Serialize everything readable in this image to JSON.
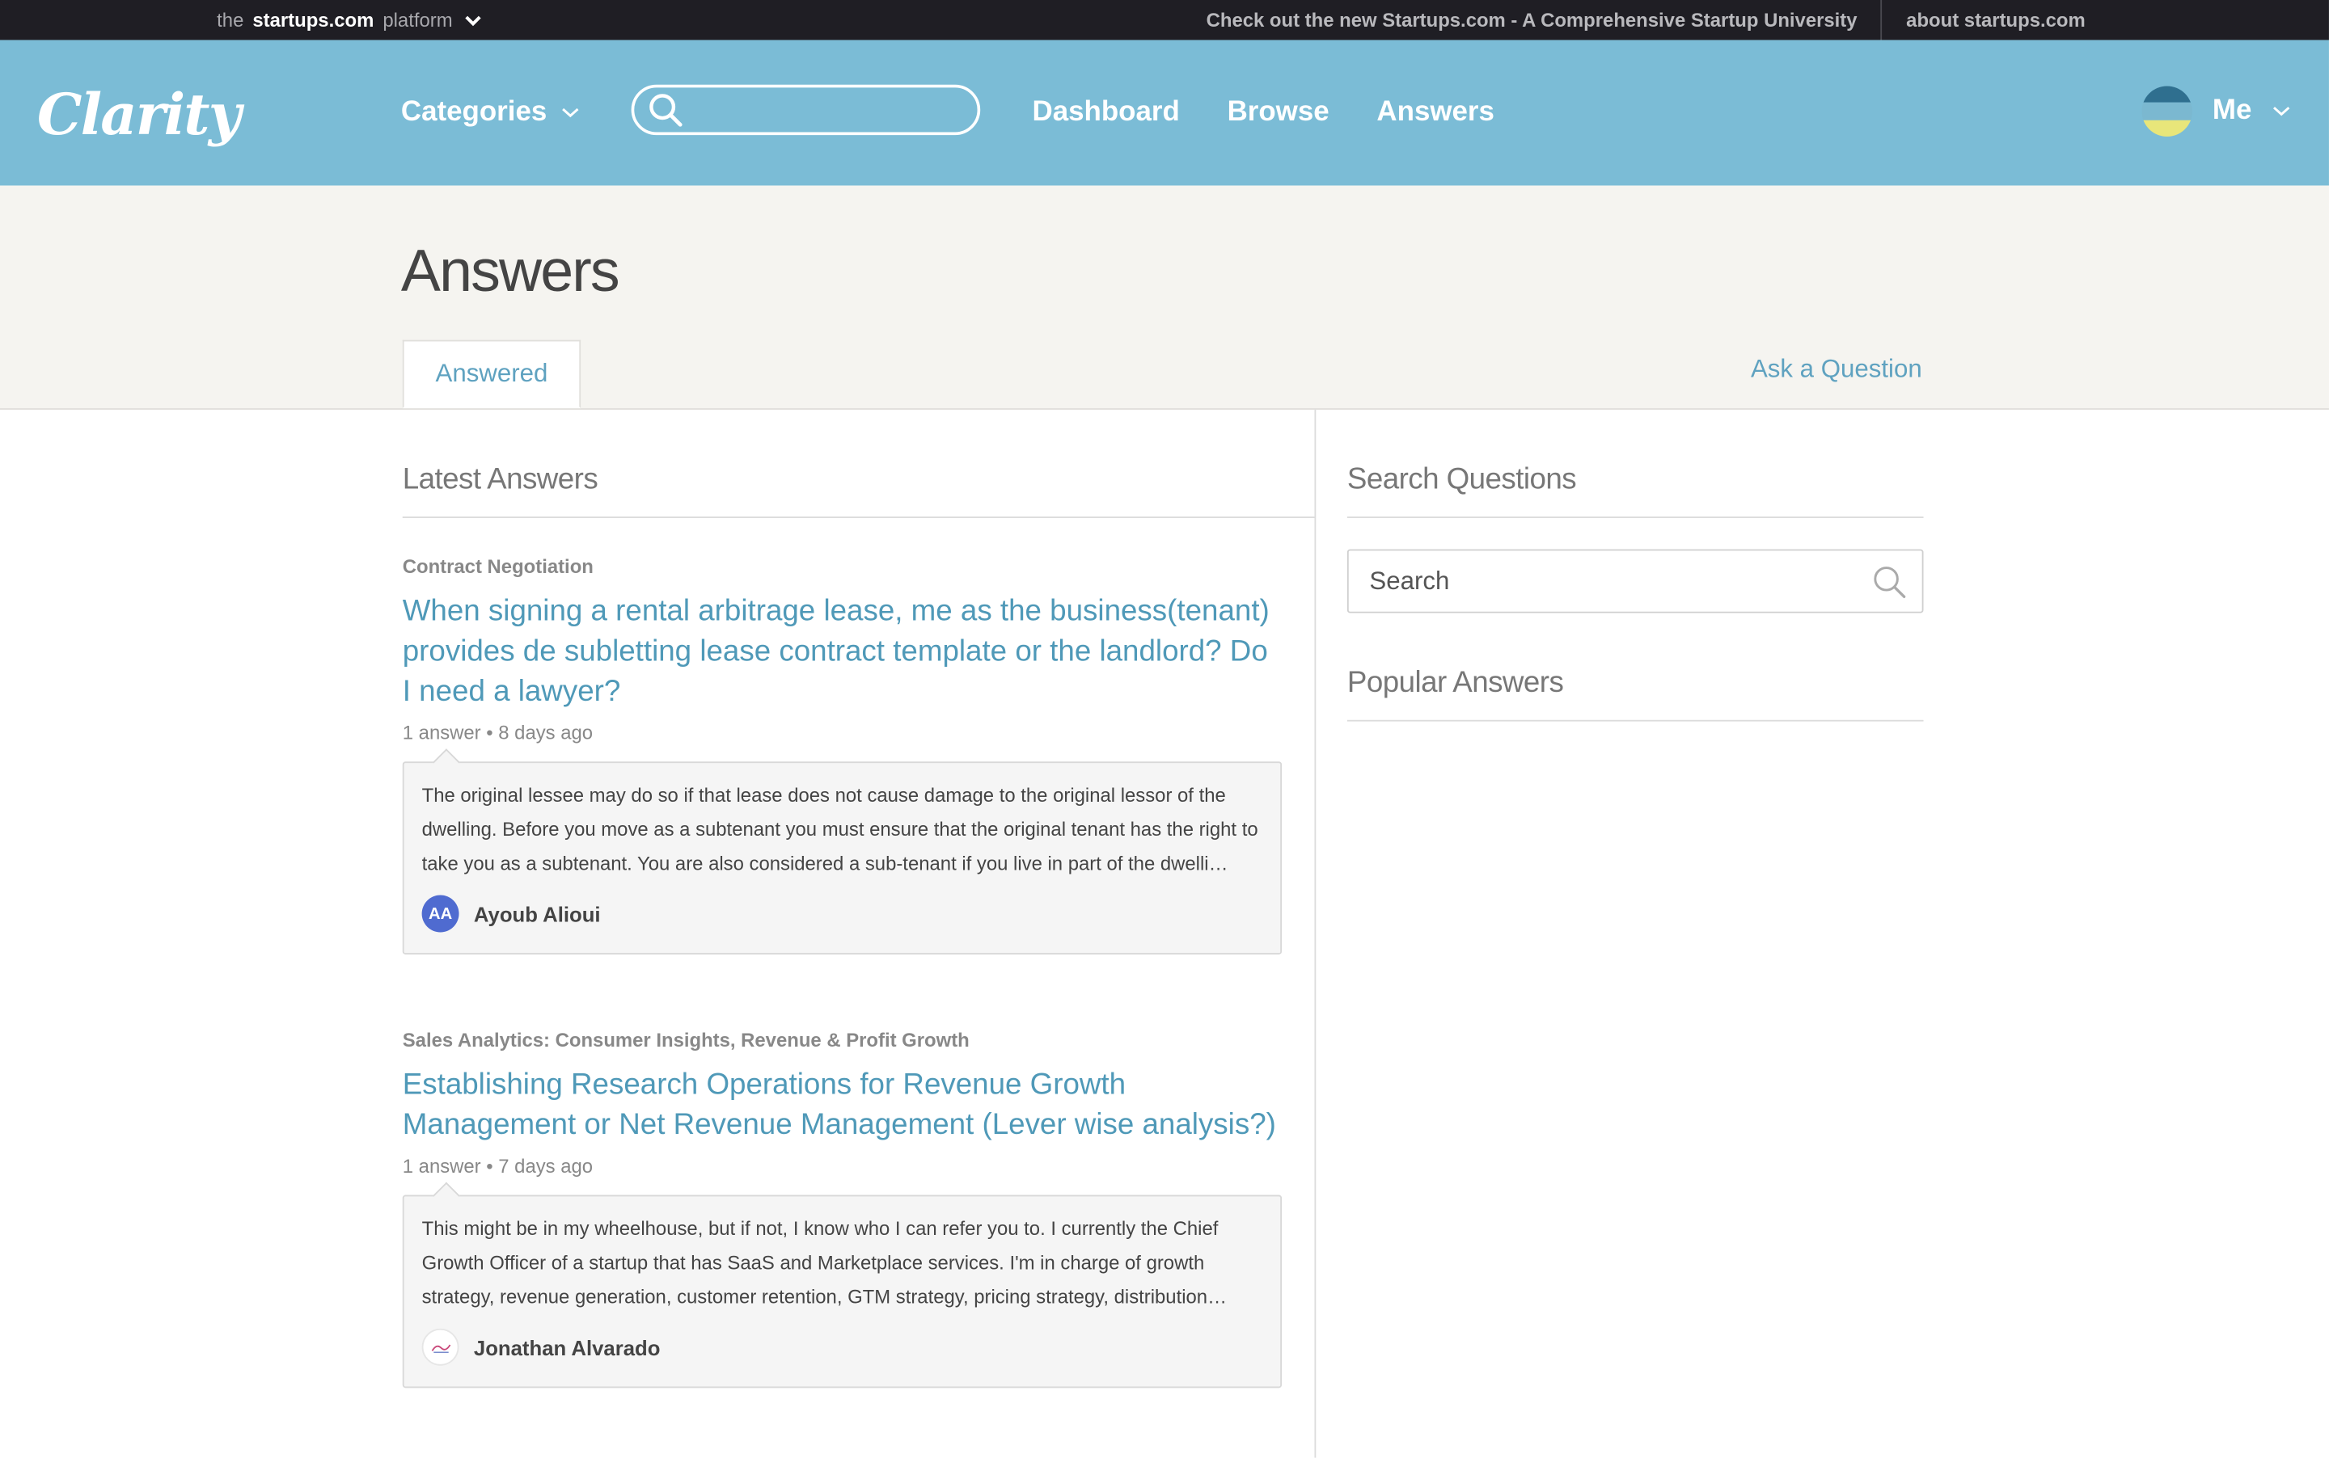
{
  "platform_bar": {
    "prefix": "the",
    "brand": "startups.com",
    "suffix": "platform",
    "promo_link": "Check out the new Startups.com - A Comprehensive Startup University",
    "about_link": "about startups.com"
  },
  "header": {
    "logo": "Clarity",
    "categories_label": "Categories",
    "search_placeholder": "",
    "nav": {
      "dashboard": "Dashboard",
      "browse": "Browse",
      "answers": "Answers"
    },
    "user_label": "Me",
    "avatar_colors": [
      "#2f6f8f",
      "#7bb8d0",
      "#e8e67a"
    ]
  },
  "page": {
    "title": "Answers",
    "tab_answered": "Answered",
    "ask_question": "Ask a Question"
  },
  "latest": {
    "heading": "Latest Answers",
    "items": [
      {
        "category": "Contract Negotiation",
        "title": "When signing a rental arbitrage lease, me as the business(tenant) provides de subletting lease contract template or the landlord? Do I need a lawyer?",
        "meta": "1 answer • 8 days ago",
        "excerpt": "The original lessee may do so if that lease does not cause damage to the original lessor of the dwelling. Before you move as a subtenant you must ensure that the original tenant has the right to take you as a subtenant. You are also considered a sub-tenant if you live in part of the dwelli…",
        "author_initials": "AA",
        "author": "Ayoub Alioui"
      },
      {
        "category": "Sales Analytics: Consumer Insights, Revenue & Profit Growth",
        "title": "Establishing Research Operations for Revenue Growth Management or Net Revenue Management (Lever wise analysis?)",
        "meta": "1 answer • 7 days ago",
        "excerpt": "This might be in my wheelhouse, but if not, I know who I can refer you to. I currently the Chief Growth Officer of a startup that has SaaS and Marketplace services. I'm in charge of growth strategy, revenue generation, customer retention, GTM strategy, pricing strategy, distribution…",
        "author_initials": "",
        "author": "Jonathan Alvarado"
      }
    ]
  },
  "sidebar": {
    "search_heading": "Search Questions",
    "search_placeholder": "Search",
    "popular_heading": "Popular Answers"
  },
  "colors": {
    "header_bg": "#7bbcd6",
    "platform_bar_bg": "#1f1e24",
    "link": "#4f99b8",
    "page_header_bg": "#f5f4f0"
  }
}
